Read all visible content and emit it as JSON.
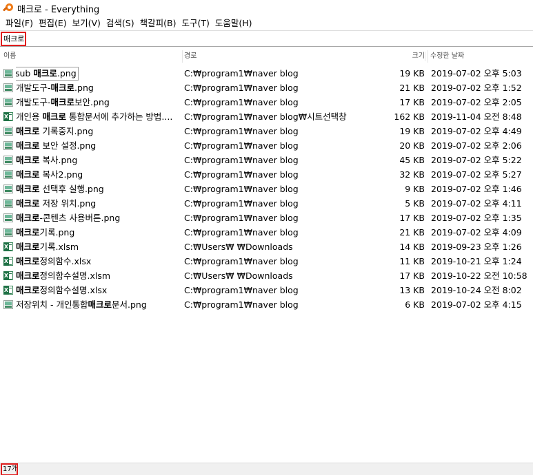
{
  "window": {
    "title": "매크로 - Everything",
    "icon": "magnifier-icon"
  },
  "menu": [
    "파일(F)",
    "편집(E)",
    "보기(V)",
    "검색(S)",
    "책갈피(B)",
    "도구(T)",
    "도움말(H)"
  ],
  "search": {
    "value": "매크로"
  },
  "columns": {
    "name": "이름",
    "path": "경로",
    "size": "크기",
    "date": "수정한 날짜"
  },
  "files": [
    {
      "pre": "sub ",
      "hit": "매크로",
      "post": ".png",
      "type": "png",
      "path": "C:₩program1₩naver blog",
      "size": "19 KB",
      "date": "2019-07-02 오후 5:03"
    },
    {
      "pre": "개발도구-",
      "hit": "매크로",
      "post": ".png",
      "type": "png",
      "path": "C:₩program1₩naver blog",
      "size": "21 KB",
      "date": "2019-07-02 오후 1:52"
    },
    {
      "pre": "개발도구-",
      "hit": "매크로",
      "post": "보안.png",
      "type": "png",
      "path": "C:₩program1₩naver blog",
      "size": "17 KB",
      "date": "2019-07-02 오후 2:05"
    },
    {
      "pre": "개인용 ",
      "hit": "매크로",
      "post": " 통합문서에 추가하는 방법....",
      "type": "xls",
      "path": "C:₩program1₩naver blog₩시트선택창",
      "size": "162 KB",
      "date": "2019-11-04 오전 8:48"
    },
    {
      "pre": "",
      "hit": "매크로",
      "post": " 기록중지.png",
      "type": "png",
      "path": "C:₩program1₩naver blog",
      "size": "19 KB",
      "date": "2019-07-02 오후 4:49"
    },
    {
      "pre": "",
      "hit": "매크로",
      "post": " 보안 설정.png",
      "type": "png",
      "path": "C:₩program1₩naver blog",
      "size": "20 KB",
      "date": "2019-07-02 오후 2:06"
    },
    {
      "pre": "",
      "hit": "매크로",
      "post": " 복사.png",
      "type": "png",
      "path": "C:₩program1₩naver blog",
      "size": "45 KB",
      "date": "2019-07-02 오후 5:22"
    },
    {
      "pre": "",
      "hit": "매크로",
      "post": " 복사2.png",
      "type": "png",
      "path": "C:₩program1₩naver blog",
      "size": "32 KB",
      "date": "2019-07-02 오후 5:27"
    },
    {
      "pre": "",
      "hit": "매크로",
      "post": " 선택후 실행.png",
      "type": "png",
      "path": "C:₩program1₩naver blog",
      "size": "9 KB",
      "date": "2019-07-02 오후 1:46"
    },
    {
      "pre": "",
      "hit": "매크로",
      "post": " 저장 위치.png",
      "type": "png",
      "path": "C:₩program1₩naver blog",
      "size": "5 KB",
      "date": "2019-07-02 오후 4:11"
    },
    {
      "pre": "",
      "hit": "매크로",
      "post": "-콘텐츠 사용버튼.png",
      "type": "png",
      "path": "C:₩program1₩naver blog",
      "size": "17 KB",
      "date": "2019-07-02 오후 1:35"
    },
    {
      "pre": "",
      "hit": "매크로",
      "post": "기록.png",
      "type": "png",
      "path": "C:₩program1₩naver blog",
      "size": "21 KB",
      "date": "2019-07-02 오후 4:09"
    },
    {
      "pre": "",
      "hit": "매크로",
      "post": "기록.xlsm",
      "type": "xls",
      "path": "C:₩Users₩            ₩Downloads",
      "size": "14 KB",
      "date": "2019-09-23 오후 1:26"
    },
    {
      "pre": "",
      "hit": "매크로",
      "post": "정의함수.xlsx",
      "type": "xls",
      "path": "C:₩program1₩naver blog",
      "size": "11 KB",
      "date": "2019-10-21 오후 1:24"
    },
    {
      "pre": "",
      "hit": "매크로",
      "post": "정의함수설명.xlsm",
      "type": "xls",
      "path": "C:₩Users₩            ₩Downloads",
      "size": "17 KB",
      "date": "2019-10-22 오전 10:58"
    },
    {
      "pre": "",
      "hit": "매크로",
      "post": "정의함수설명.xlsx",
      "type": "xls",
      "path": "C:₩program1₩naver blog",
      "size": "13 KB",
      "date": "2019-10-24 오전 8:02"
    },
    {
      "pre": "저장위치 - 개인통합",
      "hit": "매크로",
      "post": "문서.png",
      "type": "png",
      "path": "C:₩program1₩naver blog",
      "size": "6 KB",
      "date": "2019-07-02 오후 4:15"
    }
  ],
  "status": {
    "count": "17개"
  }
}
